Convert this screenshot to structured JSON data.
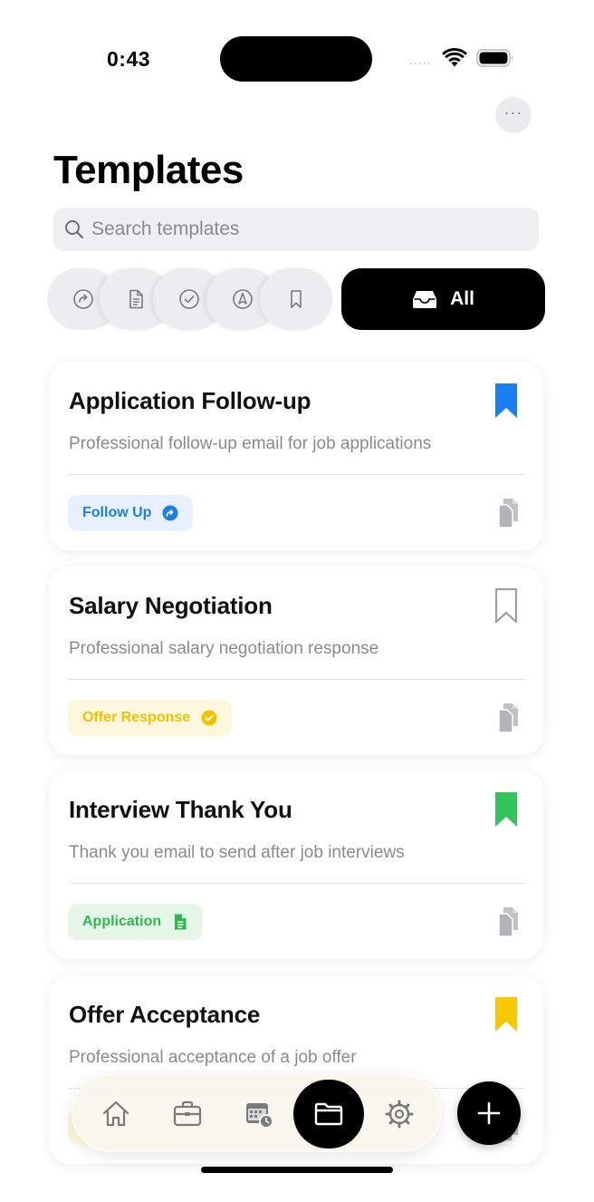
{
  "status_bar": {
    "time": "0:43",
    "signal": "....."
  },
  "header": {
    "title": "Templates",
    "more_label": "···"
  },
  "search": {
    "placeholder": "Search templates",
    "value": ""
  },
  "filters": {
    "icons": [
      "follow-up-icon",
      "document-icon",
      "checkmark-circle-icon",
      "compass-icon",
      "bookmark-icon"
    ],
    "selected_label": "All",
    "selected_icon": "tray-icon"
  },
  "templates": [
    {
      "title": "Application Follow-up",
      "description": "Professional follow-up email for job applications",
      "tag": "Follow Up",
      "tag_icon": "arrow-circle-icon",
      "tag_color": "#1f7fe0",
      "tag_bg": "#e6f1fd",
      "bookmark_color": "#1a7ef0",
      "bookmarked": true
    },
    {
      "title": "Salary Negotiation",
      "description": "Professional salary negotiation response",
      "tag": "Offer Response",
      "tag_icon": "checkmark-circle-icon",
      "tag_color": "#f2c200",
      "tag_bg": "#fdf7de",
      "bookmark_color": "#a0a0a4",
      "bookmarked": false
    },
    {
      "title": "Interview Thank You",
      "description": "Thank you email to send after job interviews",
      "tag": "Application",
      "tag_icon": "document-icon",
      "tag_color": "#2fb84f",
      "tag_bg": "#e6f7ea",
      "bookmark_color": "#33c55a",
      "bookmarked": true
    },
    {
      "title": "Offer Acceptance",
      "description": "Professional acceptance of a job offer",
      "tag": "",
      "tag_icon": "",
      "tag_color": "#f2c200",
      "tag_bg": "#fdf7de",
      "bookmark_color": "#f5c800",
      "bookmarked": true
    }
  ],
  "tab_bar": {
    "items": [
      "home-icon",
      "briefcase-icon",
      "calendar-clock-icon",
      "folder-icon",
      "gear-icon"
    ],
    "active": "folder-icon",
    "fab_icon": "plus-icon"
  },
  "colors": {
    "accent": "#000000",
    "background": "#ffffff",
    "chip_bg": "#ededf0"
  }
}
